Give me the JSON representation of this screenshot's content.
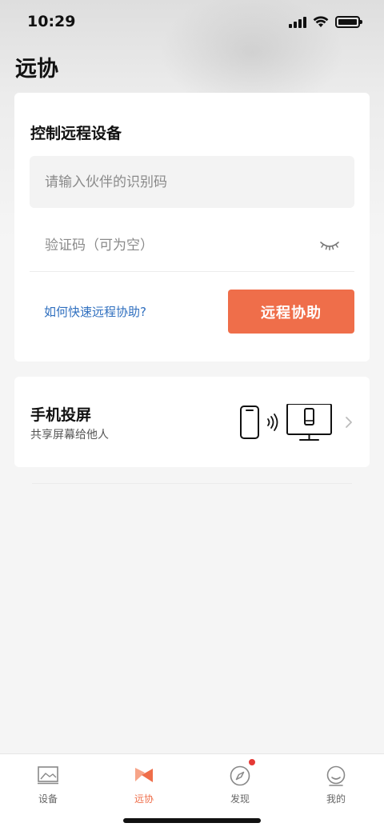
{
  "status_bar": {
    "time": "10:29"
  },
  "header": {
    "title": "远协"
  },
  "remote_control": {
    "title": "控制远程设备",
    "partner_id_placeholder": "请输入伙伴的识别码",
    "verify_code_placeholder": "验证码（可为空）",
    "help_link": "如何快速远程协助?",
    "assist_button": "远程协助"
  },
  "screen_cast": {
    "title": "手机投屏",
    "subtitle": "共享屏幕给他人"
  },
  "tab_bar": {
    "tabs": [
      {
        "label": "设备",
        "icon": "device-icon",
        "active": false
      },
      {
        "label": "远协",
        "icon": "remote-assist-icon",
        "active": true
      },
      {
        "label": "发现",
        "icon": "compass-icon",
        "active": false,
        "badge": true
      },
      {
        "label": "我的",
        "icon": "profile-icon",
        "active": false
      }
    ]
  },
  "colors": {
    "accent": "#ef6e4a",
    "link": "#2f6fbf",
    "badge": "#e53935",
    "background": "#f5f5f5"
  }
}
